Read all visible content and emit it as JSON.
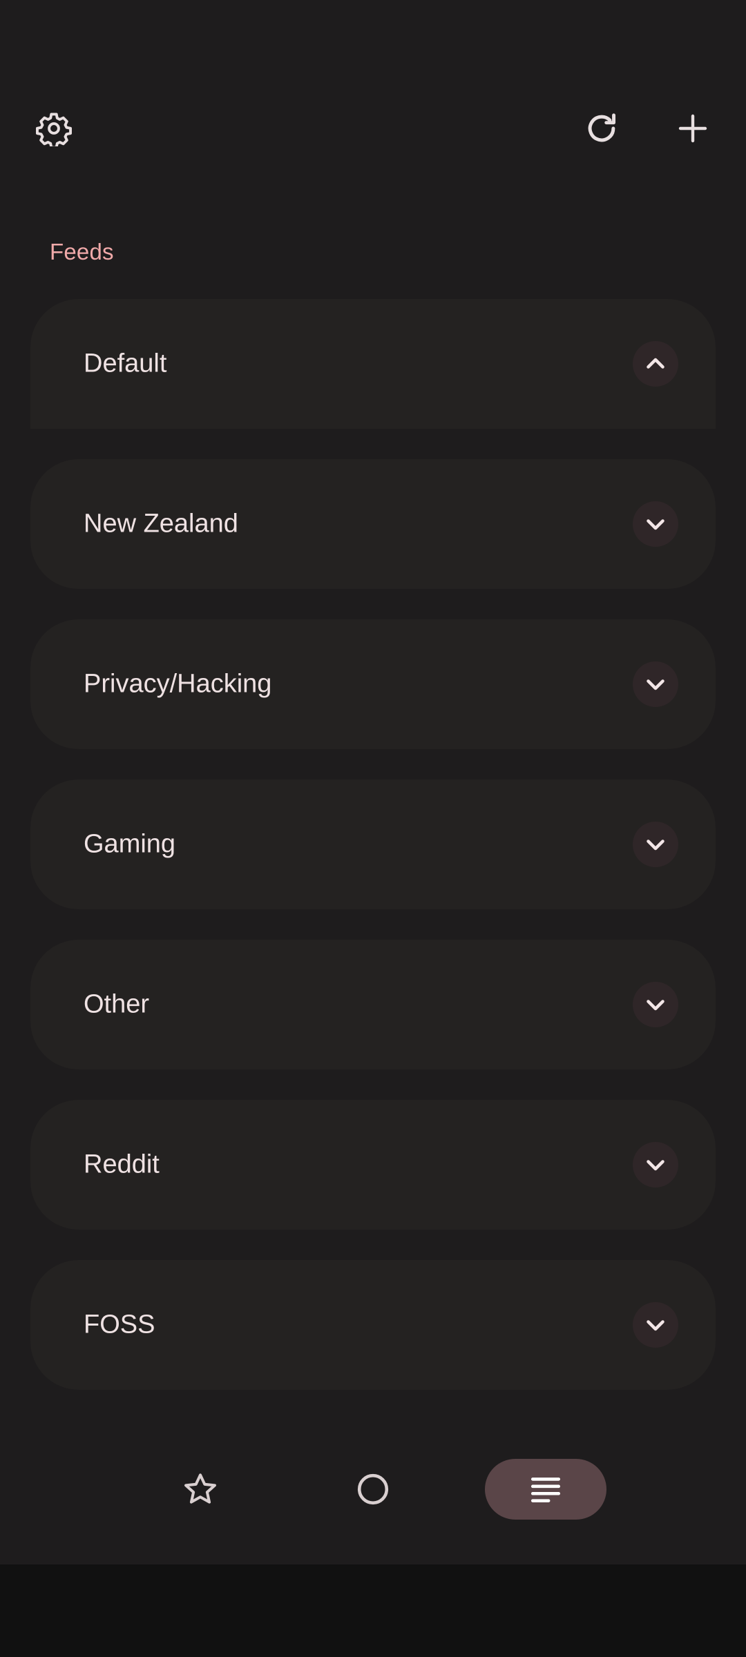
{
  "toolbar": {
    "settings_icon": "gear-icon",
    "refresh_icon": "refresh-icon",
    "add_icon": "plus-icon"
  },
  "section": {
    "title": "Feeds"
  },
  "groups": [
    {
      "label": "Default",
      "expanded": true
    },
    {
      "label": "New Zealand",
      "expanded": false
    },
    {
      "label": "Privacy/Hacking",
      "expanded": false
    },
    {
      "label": "Gaming",
      "expanded": false
    },
    {
      "label": "Other",
      "expanded": false
    },
    {
      "label": "Reddit",
      "expanded": false
    },
    {
      "label": "FOSS",
      "expanded": false
    }
  ],
  "bottom_nav": {
    "items": [
      {
        "icon": "star-icon",
        "active": false
      },
      {
        "icon": "circle-icon",
        "active": false
      },
      {
        "icon": "list-icon",
        "active": true
      }
    ]
  },
  "colors": {
    "background": "#1e1c1d",
    "card": "#242221",
    "accent_label": "#f0a9a9",
    "active_nav": "#5a4548",
    "text": "#ece0e1"
  }
}
